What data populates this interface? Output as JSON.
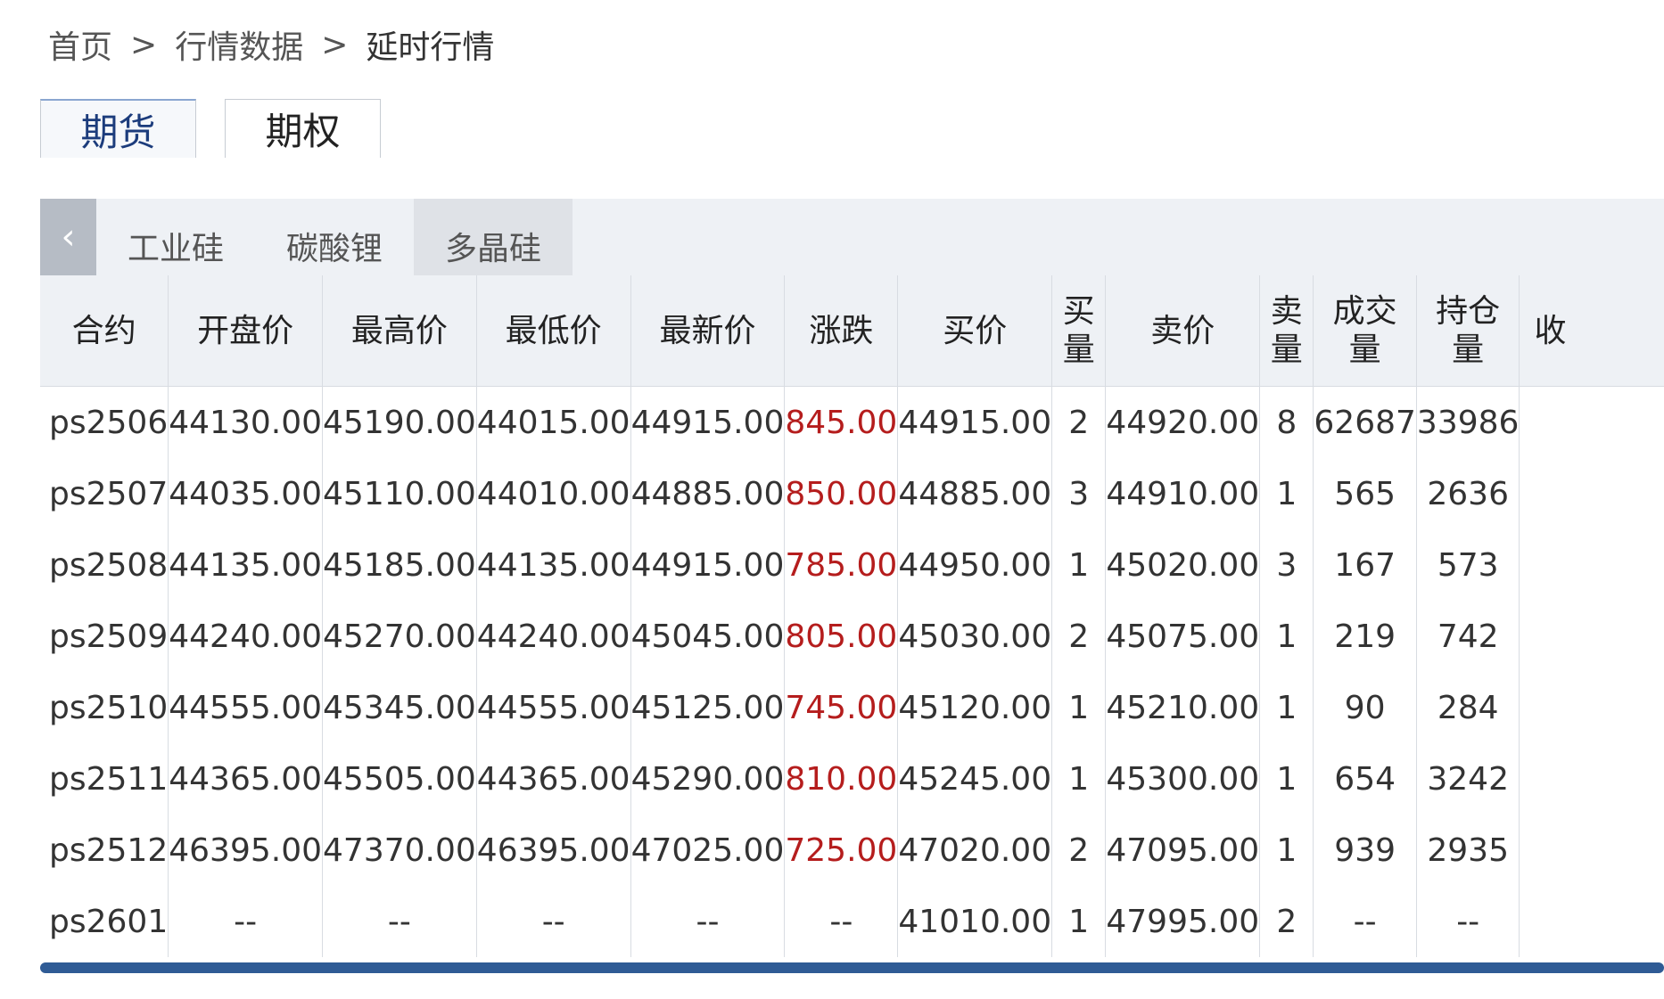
{
  "breadcrumb": {
    "home": "首页",
    "sep1": ">",
    "market": "行情数据",
    "sep2": ">",
    "current": "延时行情"
  },
  "main_tabs": [
    {
      "label": "期货",
      "active": true
    },
    {
      "label": "期权",
      "active": false
    }
  ],
  "back_icon": "chevron-left-icon",
  "back_glyph": "‹",
  "sub_tabs": [
    {
      "label": "工业硅",
      "active": false
    },
    {
      "label": "碳酸锂",
      "active": false
    },
    {
      "label": "多晶硅",
      "active": true
    }
  ],
  "table": {
    "headers": [
      "合约",
      "开盘价",
      "最高价",
      "最低价",
      "最新价",
      "涨跌",
      "买价",
      "买量",
      "卖价",
      "卖量",
      "成交\n量",
      "持仓\n量",
      "收"
    ],
    "rows": [
      [
        "ps2506",
        "44130.00",
        "45190.00",
        "44015.00",
        "44915.00",
        "845.00",
        "44915.00",
        "2",
        "44920.00",
        "8",
        "62687",
        "33986"
      ],
      [
        "ps2507",
        "44035.00",
        "45110.00",
        "44010.00",
        "44885.00",
        "850.00",
        "44885.00",
        "3",
        "44910.00",
        "1",
        "565",
        "2636"
      ],
      [
        "ps2508",
        "44135.00",
        "45185.00",
        "44135.00",
        "44915.00",
        "785.00",
        "44950.00",
        "1",
        "45020.00",
        "3",
        "167",
        "573"
      ],
      [
        "ps2509",
        "44240.00",
        "45270.00",
        "44240.00",
        "45045.00",
        "805.00",
        "45030.00",
        "2",
        "45075.00",
        "1",
        "219",
        "742"
      ],
      [
        "ps2510",
        "44555.00",
        "45345.00",
        "44555.00",
        "45125.00",
        "745.00",
        "45120.00",
        "1",
        "45210.00",
        "1",
        "90",
        "284"
      ],
      [
        "ps2511",
        "44365.00",
        "45505.00",
        "44365.00",
        "45290.00",
        "810.00",
        "45245.00",
        "1",
        "45300.00",
        "1",
        "654",
        "3242"
      ],
      [
        "ps2512",
        "46395.00",
        "47370.00",
        "46395.00",
        "47025.00",
        "725.00",
        "47020.00",
        "2",
        "47095.00",
        "1",
        "939",
        "2935"
      ],
      [
        "ps2601",
        "--",
        "--",
        "--",
        "--",
        "--",
        "41010.00",
        "1",
        "47995.00",
        "2",
        "--",
        "--"
      ]
    ]
  },
  "colors": {
    "up": "#b51d1d",
    "active_tab_text": "#1c3c7c",
    "scrollbar": "#2f5b95"
  }
}
